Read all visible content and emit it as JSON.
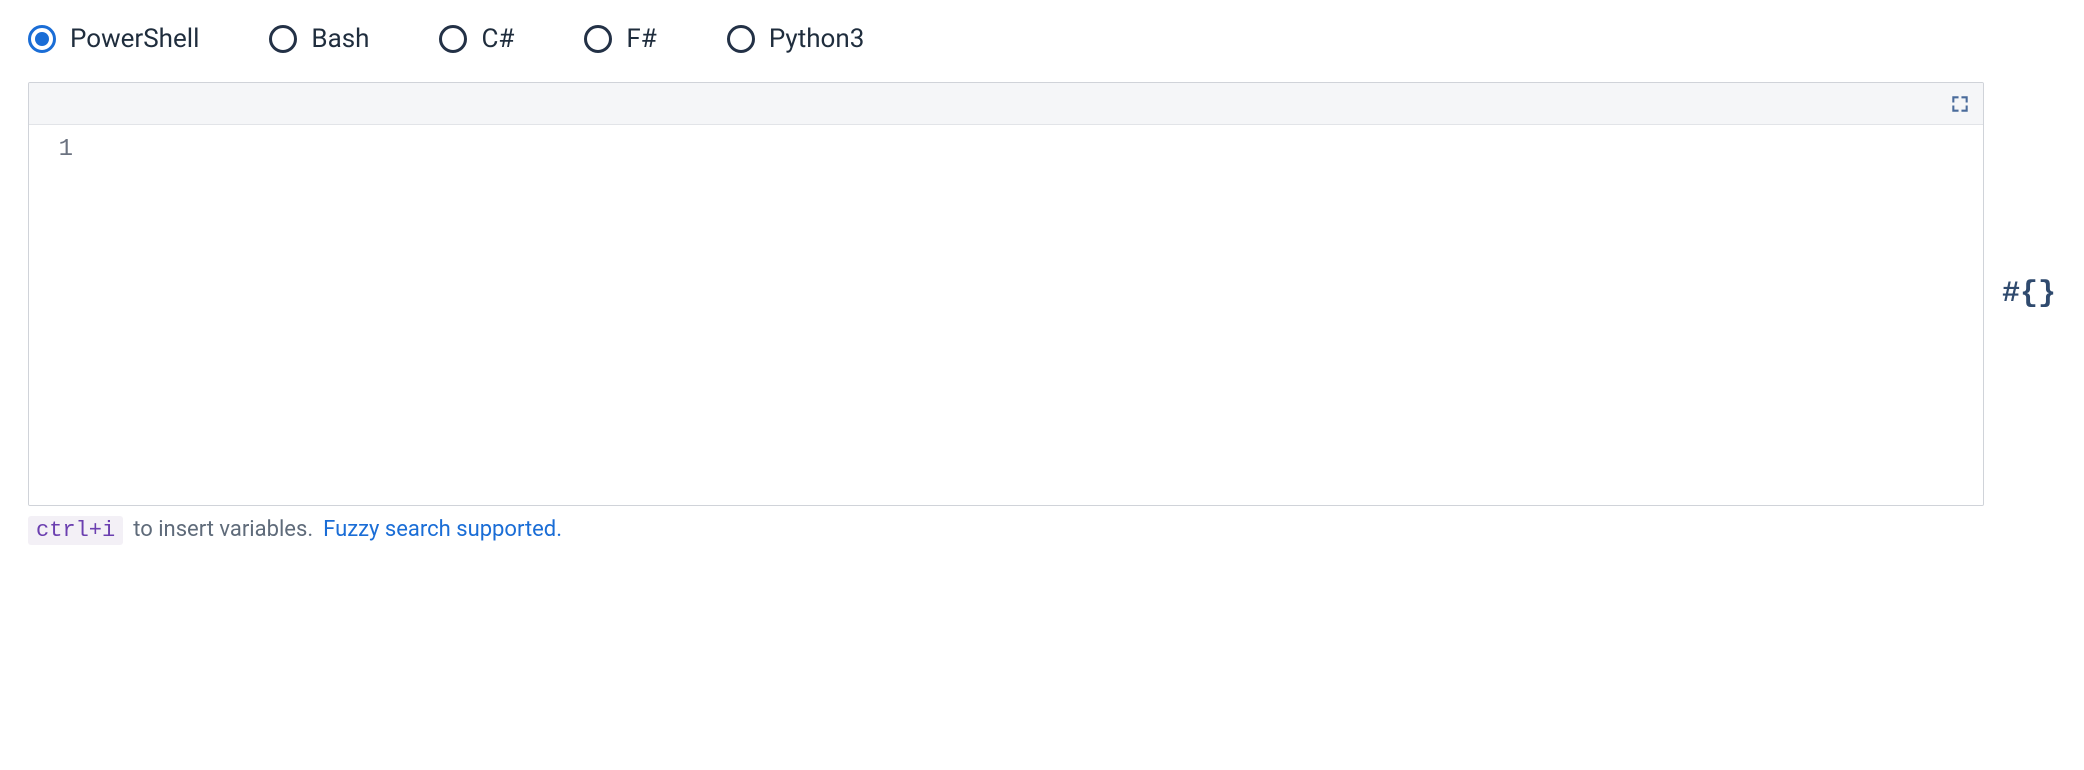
{
  "language_options": [
    {
      "id": "powershell",
      "label": "PowerShell",
      "selected": true
    },
    {
      "id": "bash",
      "label": "Bash",
      "selected": false
    },
    {
      "id": "csharp",
      "label": "C#",
      "selected": false
    },
    {
      "id": "fsharp",
      "label": "F#",
      "selected": false
    },
    {
      "id": "python3",
      "label": "Python3",
      "selected": false
    }
  ],
  "editor": {
    "line_numbers": [
      "1"
    ],
    "content": ""
  },
  "side_token": "#{}",
  "hint": {
    "kbd": "ctrl+i",
    "text_after_kbd": " to insert variables. ",
    "link_text": "Fuzzy search supported."
  }
}
